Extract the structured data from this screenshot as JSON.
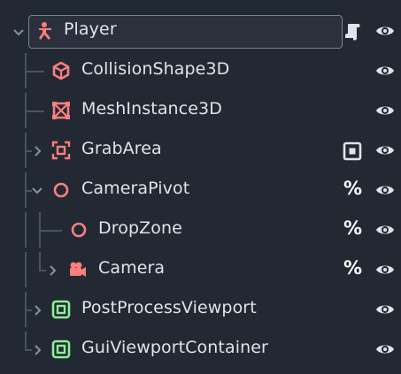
{
  "scene_tree": {
    "nodes": [
      {
        "name": "Player",
        "icon": "character-body-3d-icon",
        "depth": 0,
        "expander": "expanded",
        "selected": true,
        "extras": [
          "script-icon"
        ],
        "visible": true
      },
      {
        "name": "CollisionShape3D",
        "icon": "collision-shape-3d-icon",
        "depth": 1,
        "expander": "none",
        "extras": [],
        "visible": true
      },
      {
        "name": "MeshInstance3D",
        "icon": "mesh-instance-3d-icon",
        "depth": 1,
        "expander": "none",
        "extras": [],
        "visible": true
      },
      {
        "name": "GrabArea",
        "icon": "area-3d-icon",
        "depth": 1,
        "expander": "collapsed",
        "extras": [
          "group-icon"
        ],
        "visible": true
      },
      {
        "name": "CameraPivot",
        "icon": "node-3d-icon",
        "depth": 1,
        "expander": "expanded",
        "extras": [
          "unique-name-icon"
        ],
        "visible": true
      },
      {
        "name": "DropZone",
        "icon": "node-3d-icon",
        "depth": 2,
        "expander": "none",
        "extras": [
          "unique-name-icon"
        ],
        "visible": true
      },
      {
        "name": "Camera",
        "icon": "camera-3d-icon",
        "depth": 2,
        "expander": "collapsed",
        "extras": [
          "unique-name-icon"
        ],
        "visible": true
      },
      {
        "name": "PostProcessViewport",
        "icon": "subviewport-icon",
        "depth": 1,
        "expander": "collapsed",
        "extras": [],
        "visible": true
      },
      {
        "name": "GuiViewportContainer",
        "icon": "subviewport-icon",
        "depth": 1,
        "expander": "collapsed",
        "extras": [],
        "visible": true
      }
    ],
    "unique_name_marker": "%"
  },
  "colors": {
    "background": "#232933",
    "node3d_red": "#fc7f7f",
    "viewport_green": "#8eef97",
    "text": "#e0e4ea",
    "guide": "#4b535e"
  }
}
